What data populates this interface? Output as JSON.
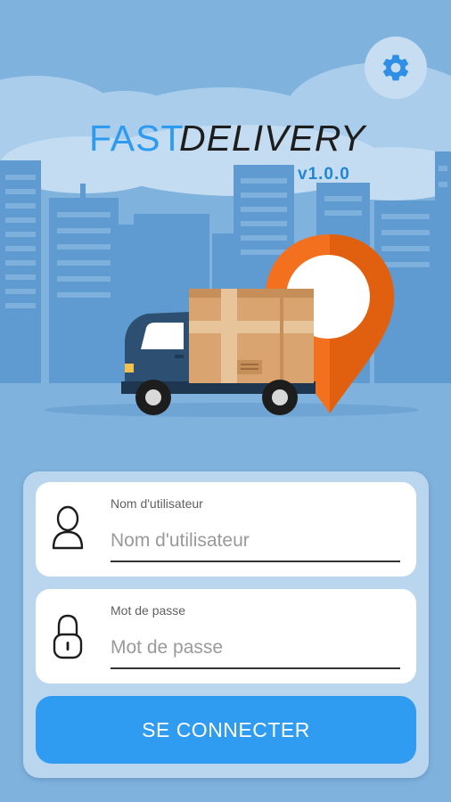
{
  "app": {
    "logo_fast": "FAST",
    "logo_delivery": "DELIVERY",
    "version": "v1.0.0"
  },
  "icons": {
    "settings": "gear-icon",
    "user": "user-icon",
    "password": "lock-icon"
  },
  "form": {
    "username": {
      "label": "Nom d'utilisateur",
      "placeholder": "Nom d'utilisateur",
      "value": ""
    },
    "password": {
      "label": "Mot de passe",
      "placeholder": "Mot de passe",
      "value": ""
    },
    "submit_label": "SE CONNECTER"
  },
  "colors": {
    "background": "#7fb2dd",
    "accent": "#2f9bf1",
    "pin": "#f3701f",
    "card": "#bad5ee"
  }
}
